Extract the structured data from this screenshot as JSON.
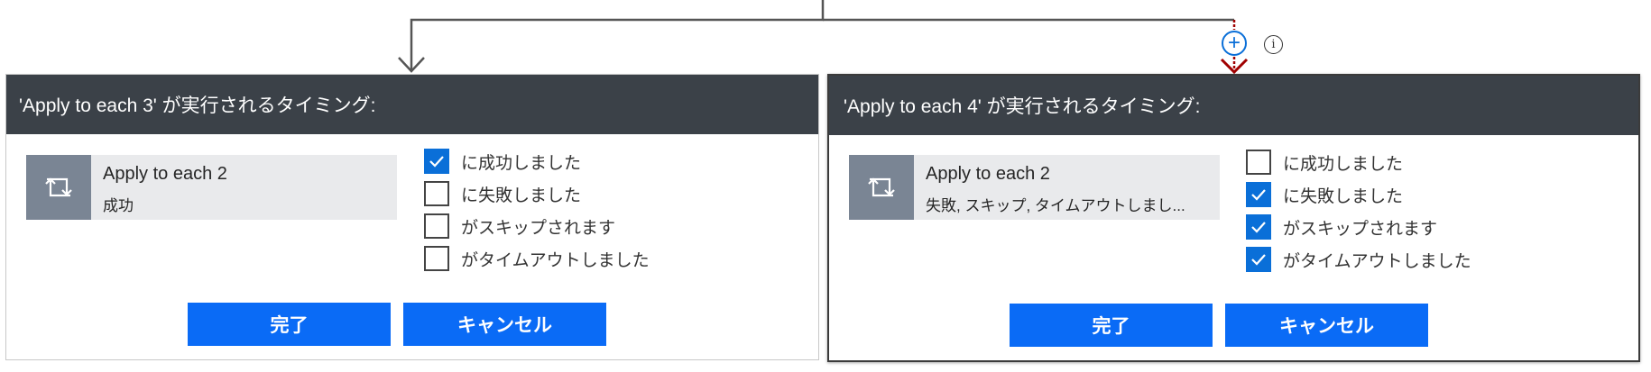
{
  "colors": {
    "header_bg": "#3b4148",
    "accent_blue": "#0a6bf6",
    "checkbox_blue": "#0a6fd8",
    "tile_icon_bg": "#7a8594",
    "tile_bg": "#e9eaec",
    "connector_gray": "#555555",
    "connector_red": "#a00000"
  },
  "icons": {
    "add_step": "plus-circle-icon",
    "info": "info-icon",
    "loop": "loop-icon",
    "checkmark": "checkmark-icon",
    "arrow_down": "arrow-down-icon"
  },
  "info_glyph": "i",
  "add_glyph": "+",
  "cards": [
    {
      "header": "'Apply to each 3' が実行されるタイミング:",
      "tile": {
        "title": "Apply to each 2",
        "subtitle": "成功"
      },
      "options": [
        {
          "label": "に成功しました",
          "checked": true
        },
        {
          "label": "に失敗しました",
          "checked": false
        },
        {
          "label": "がスキップされます",
          "checked": false
        },
        {
          "label": "がタイムアウトしました",
          "checked": false
        }
      ],
      "done_label": "完了",
      "cancel_label": "キャンセル"
    },
    {
      "header": "'Apply to each 4' が実行されるタイミング:",
      "tile": {
        "title": "Apply to each 2",
        "subtitle": "失敗, スキップ, タイムアウトしまし..."
      },
      "options": [
        {
          "label": "に成功しました",
          "checked": false
        },
        {
          "label": "に失敗しました",
          "checked": true
        },
        {
          "label": "がスキップされます",
          "checked": true
        },
        {
          "label": "がタイムアウトしました",
          "checked": true
        }
      ],
      "done_label": "完了",
      "cancel_label": "キャンセル"
    }
  ]
}
